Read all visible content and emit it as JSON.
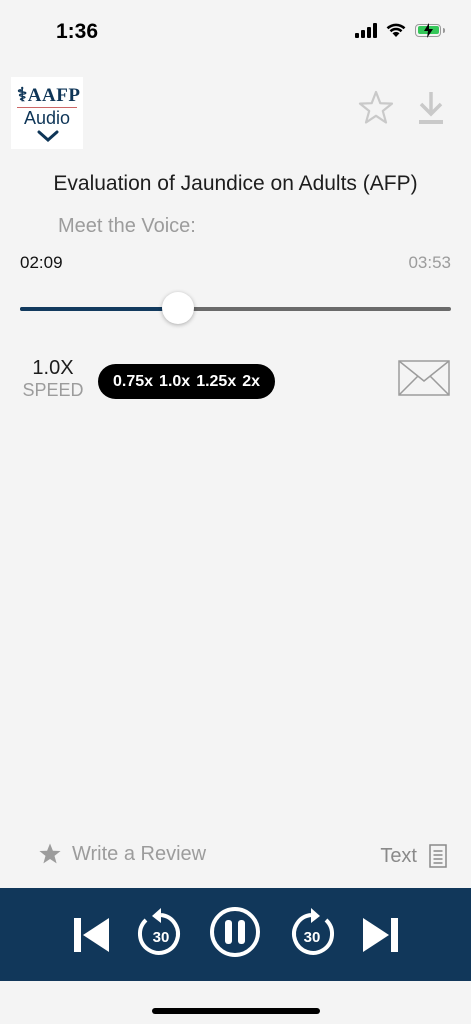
{
  "status": {
    "time": "1:36"
  },
  "logo": {
    "org": "AAFP",
    "product": "Audio"
  },
  "track": {
    "title": "Evaluation of Jaundice on Adults (AFP)",
    "voice_label": "Meet the Voice:",
    "current_time": "02:09",
    "total_time": "03:53",
    "progress": 0.367
  },
  "speed": {
    "value": "1.0X",
    "label": "SPEED",
    "options": [
      "0.75x",
      "1.0x",
      "1.25x",
      "2x"
    ]
  },
  "footer": {
    "review_label": "Write a Review",
    "text_label": "Text"
  },
  "player": {
    "rewind_seconds": "30",
    "forward_seconds": "30"
  },
  "colors": {
    "accent": "#11375a",
    "background": "#f4f4f4",
    "muted": "#9c9c9c",
    "battery": "#34c759"
  }
}
